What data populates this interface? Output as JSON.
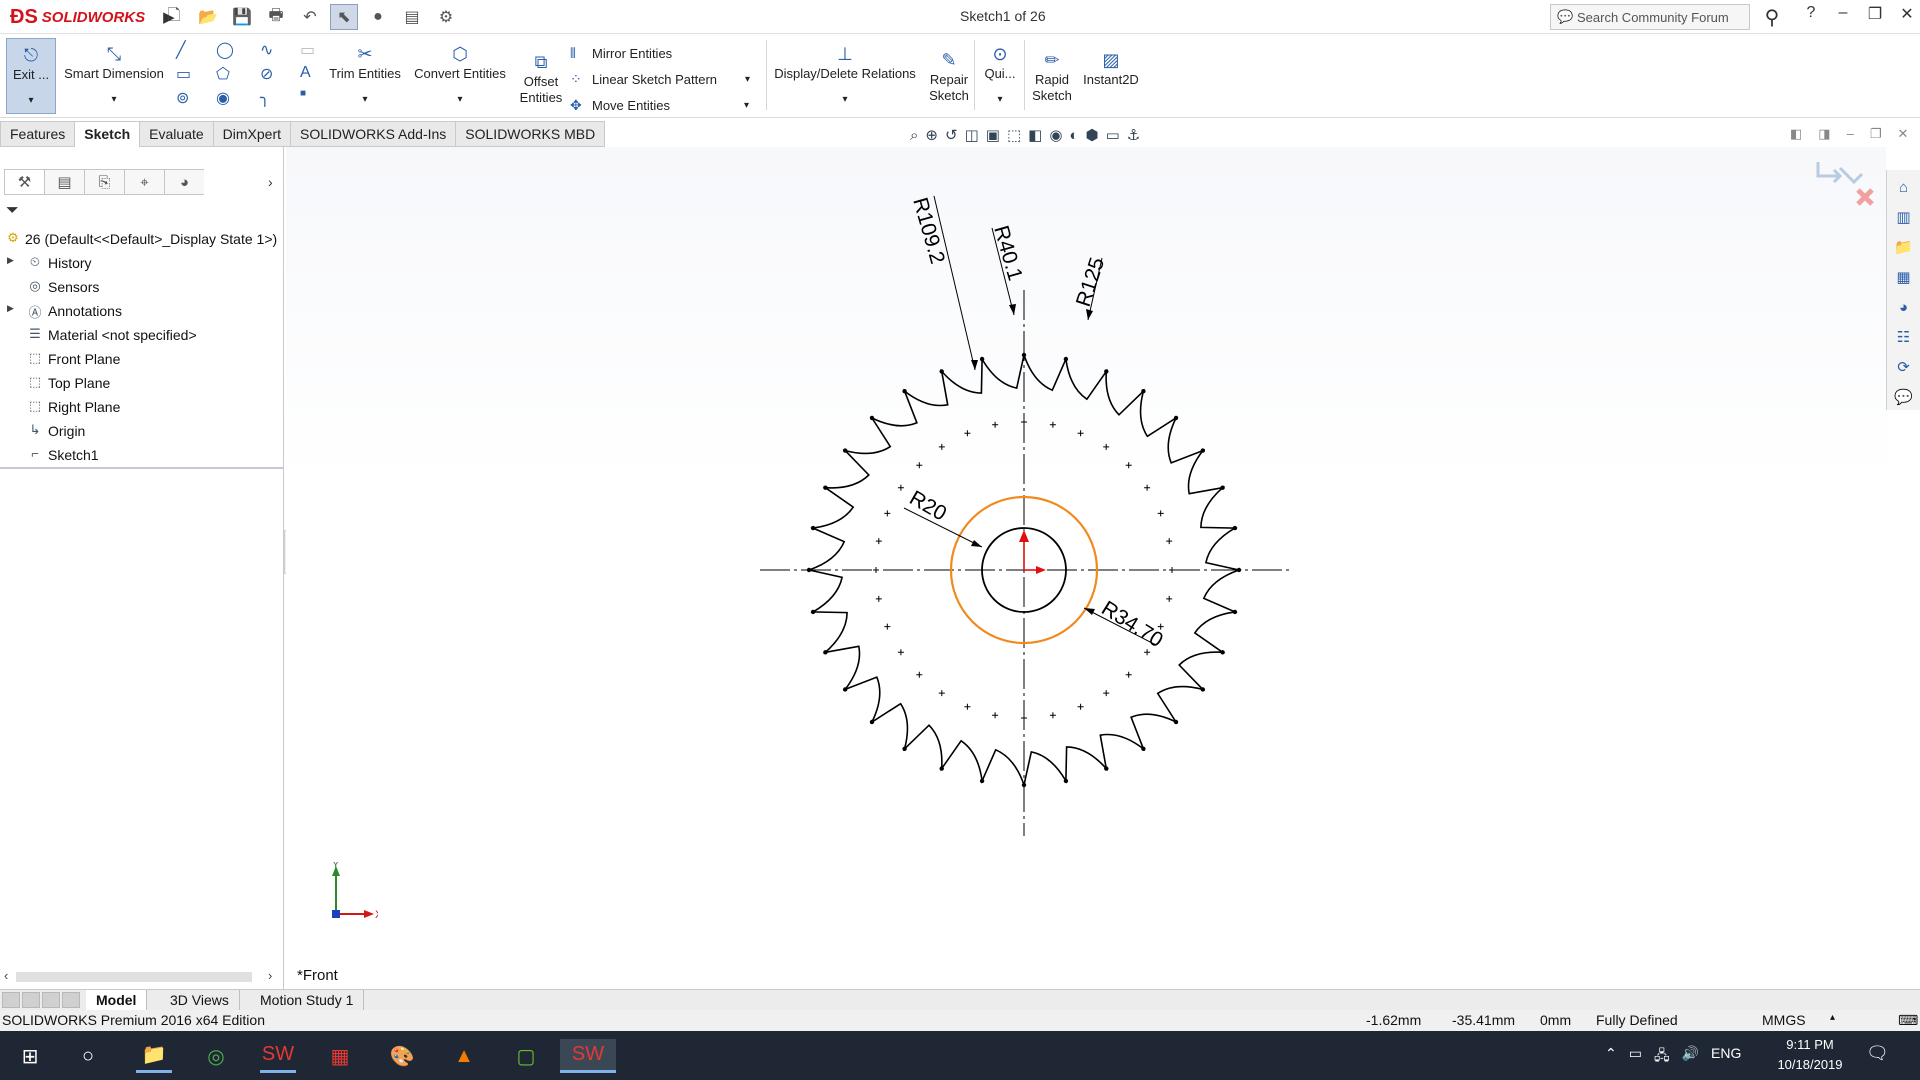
{
  "app": {
    "name": "SOLIDWORKS",
    "document_title": "Sketch1 of 26"
  },
  "quick_access": {
    "icons": [
      "new-icon",
      "open-icon",
      "save-icon",
      "print-icon",
      "undo-icon",
      "select-icon",
      "rebuild-icon",
      "file-props-icon",
      "options-icon"
    ]
  },
  "search": {
    "placeholder": "Search Community Forum"
  },
  "window_controls": {
    "help": "?",
    "minimize": "–",
    "restore": "❐",
    "close": "✕"
  },
  "command_manager": {
    "exit_sketch": "Exit ...",
    "smart_dimension": "Smart Dimension",
    "trim_entities": "Trim Entities",
    "convert_entities": "Convert Entities",
    "offset_entities_1": "Offset",
    "offset_entities_2": "Entities",
    "mirror_entities": "Mirror Entities",
    "linear_sketch_pattern": "Linear Sketch Pattern",
    "move_entities": "Move Entities",
    "display_delete_relations": "Display/Delete Relations",
    "repair_sketch_1": "Repair",
    "repair_sketch_2": "Sketch",
    "quick_snaps": "Qui...",
    "rapid_sketch_1": "Rapid",
    "rapid_sketch_2": "Sketch",
    "instant2d": "Instant2D"
  },
  "tabs": [
    "Features",
    "Sketch",
    "Evaluate",
    "DimXpert",
    "SOLIDWORKS Add-Ins",
    "SOLIDWORKS MBD"
  ],
  "active_tab": "Sketch",
  "feature_tree": {
    "root": "26  (Default<<Default>_Display State 1>)",
    "items": [
      {
        "label": "History",
        "icon": "history-icon",
        "expandable": true
      },
      {
        "label": "Sensors",
        "icon": "sensors-icon",
        "expandable": false
      },
      {
        "label": "Annotations",
        "icon": "annotations-icon",
        "expandable": true
      },
      {
        "label": "Material <not specified>",
        "icon": "material-icon",
        "expandable": false
      },
      {
        "label": "Front Plane",
        "icon": "plane-icon",
        "expandable": false
      },
      {
        "label": "Top Plane",
        "icon": "plane-icon",
        "expandable": false
      },
      {
        "label": "Right Plane",
        "icon": "plane-icon",
        "expandable": false
      },
      {
        "label": "Origin",
        "icon": "origin-icon",
        "expandable": false
      },
      {
        "label": "Sketch1",
        "icon": "sketch-icon",
        "expandable": false
      }
    ]
  },
  "graphics": {
    "view_label": "*Front",
    "dimensions": {
      "r_tip": "R109.2",
      "r_gullet": "R40.1",
      "r_outer": "R125",
      "r_bore": "R20",
      "r_flange": "R34.70"
    },
    "teeth_count": 32,
    "colors": {
      "sketch": "#000000",
      "selected": "#f08a1c",
      "origin_arrow": "#e01010"
    },
    "triad": {
      "x": "X",
      "y": "Y"
    }
  },
  "bottom_tabs": [
    "Model",
    "3D Views",
    "Motion Study 1"
  ],
  "active_bottom_tab": "Model",
  "status_bar": {
    "edition": "SOLIDWORKS Premium 2016 x64 Edition",
    "x": "-1.62mm",
    "y": "-35.41mm",
    "z": "0mm",
    "state": "Fully Defined",
    "units": "MMGS"
  },
  "taskbar": {
    "language": "ENG",
    "time": "9:11 PM",
    "date": "10/18/2019"
  }
}
